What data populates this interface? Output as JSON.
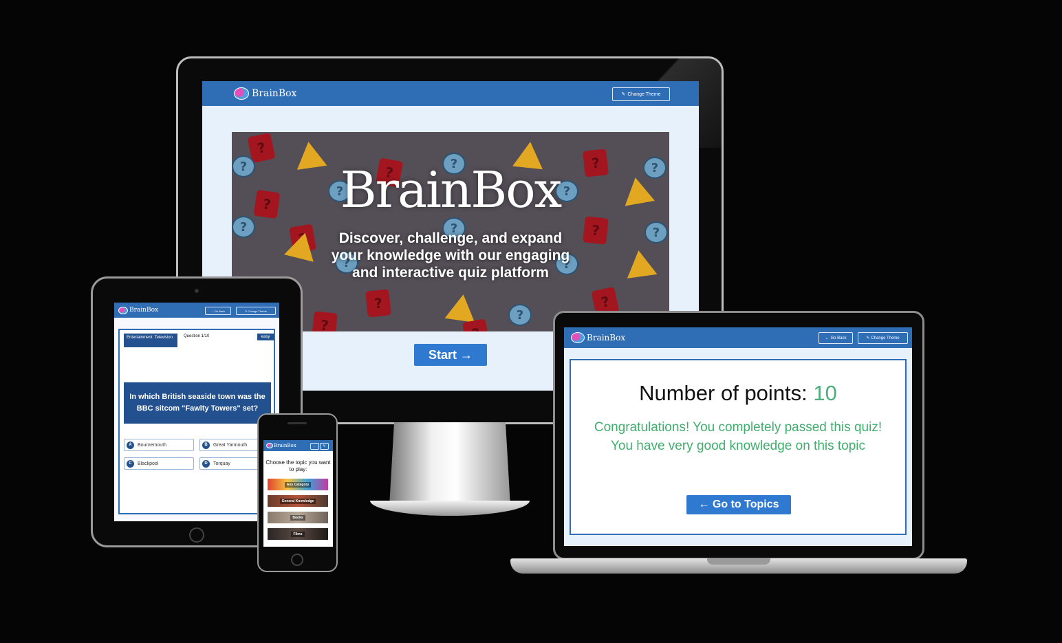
{
  "brand": {
    "name": "BrainBox"
  },
  "nav": {
    "change_theme_label": "Change Theme",
    "go_back_label": "Go Back",
    "edit_icon": "edit-icon",
    "back_icon": "arrow-left-icon"
  },
  "desktop": {
    "hero_title": "BrainBox",
    "hero_subtitle": "Discover, challenge, and expand your knowledge with our engaging and interactive quiz platform",
    "start_label": "Start →"
  },
  "laptop": {
    "points_label": "Number of points:",
    "points_value": "10",
    "congrats_text": "Congratulations! You completely passed this quiz! You have very good knowledge on this topic",
    "go_to_topics_label": "← Go to Topics"
  },
  "tablet": {
    "category": "Entertainment: Television",
    "question_number": "Question 1/10",
    "difficulty": "easy",
    "question": "In which British seaside town was the BBC sitcom \"Fawlty Towers\" set?",
    "answers": [
      {
        "letter": "A",
        "text": "Bournemouth"
      },
      {
        "letter": "B",
        "text": "Great Yarmouth"
      },
      {
        "letter": "C",
        "text": "Blackpool"
      },
      {
        "letter": "D",
        "text": "Torquay"
      }
    ]
  },
  "phone": {
    "prompt": "Choose the topic you want to play:",
    "topics": [
      "Any Category",
      "General Knowledge",
      "Books",
      "Films"
    ]
  },
  "colors": {
    "navbar": "#2f6db5",
    "button": "#2f7ad0",
    "dark_blue": "#23518f",
    "success_green": "#3fae6c",
    "screen_bg": "#e6f1fb"
  }
}
